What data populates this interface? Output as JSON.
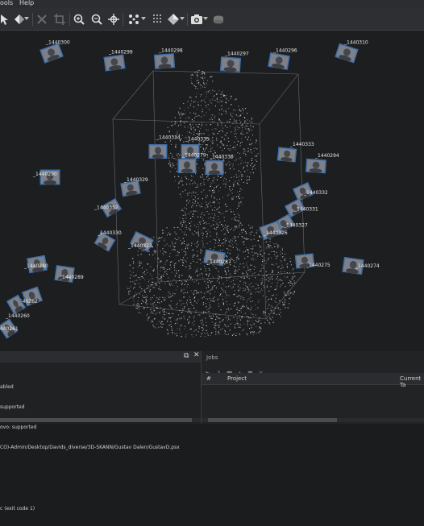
{
  "menubar": {
    "items": [
      {
        "label": "ools"
      },
      {
        "label": "Help"
      }
    ]
  },
  "toolbar": {
    "icons": [
      "navigation-icon",
      "brush-icon",
      "select-icon",
      "delete-icon",
      "crop-icon",
      "zoom-in-icon",
      "zoom-out-icon",
      "move-icon",
      "points-icon",
      "surface-icon",
      "camera-icon",
      "layers-icon"
    ]
  },
  "viewport": {
    "cameras": [
      {
        "label": "_1440300"
      },
      {
        "label": "_1440299"
      },
      {
        "label": "_1440298"
      },
      {
        "label": "_1440297"
      },
      {
        "label": "_1440296"
      },
      {
        "label": "_1440310"
      },
      {
        "label": "_1440334"
      },
      {
        "label": "_1440335"
      },
      {
        "label": "_1440279"
      },
      {
        "label": "_1440336"
      },
      {
        "label": "_1440333"
      },
      {
        "label": "_1440294"
      },
      {
        "label": "_1440290"
      },
      {
        "label": "_1440329"
      },
      {
        "label": "_1440332"
      },
      {
        "label": "_1440331"
      },
      {
        "label": "_1440352"
      },
      {
        "label": "_1440327"
      },
      {
        "label": "_1440330"
      },
      {
        "label": "_1440326"
      },
      {
        "label": "_1440323"
      },
      {
        "label": "_1440287"
      },
      {
        "label": "_1440275"
      },
      {
        "label": "_1440274"
      },
      {
        "label": "_1440280"
      },
      {
        "label": "_1440289"
      },
      {
        "label": "_1440262"
      },
      {
        "label": "_1440260"
      },
      {
        "label": "_1440261"
      }
    ]
  },
  "console": {
    "lines": [
      "abled",
      "supported",
      "ovo: supported",
      "CO)-Admin/Desktop/Davids_diverse/3D-SKANN/Gustav Dalen/GustavD.psx",
      "",
      "",
      "c (exit code 1)"
    ]
  },
  "jobs": {
    "title": "Jobs",
    "columns": {
      "num": "#",
      "project": "Project",
      "task": "Current Ta"
    }
  },
  "colors": {
    "accent": "#3d6ea8",
    "point_cloud": "#9a9a9a",
    "background": "#1d1e20"
  }
}
